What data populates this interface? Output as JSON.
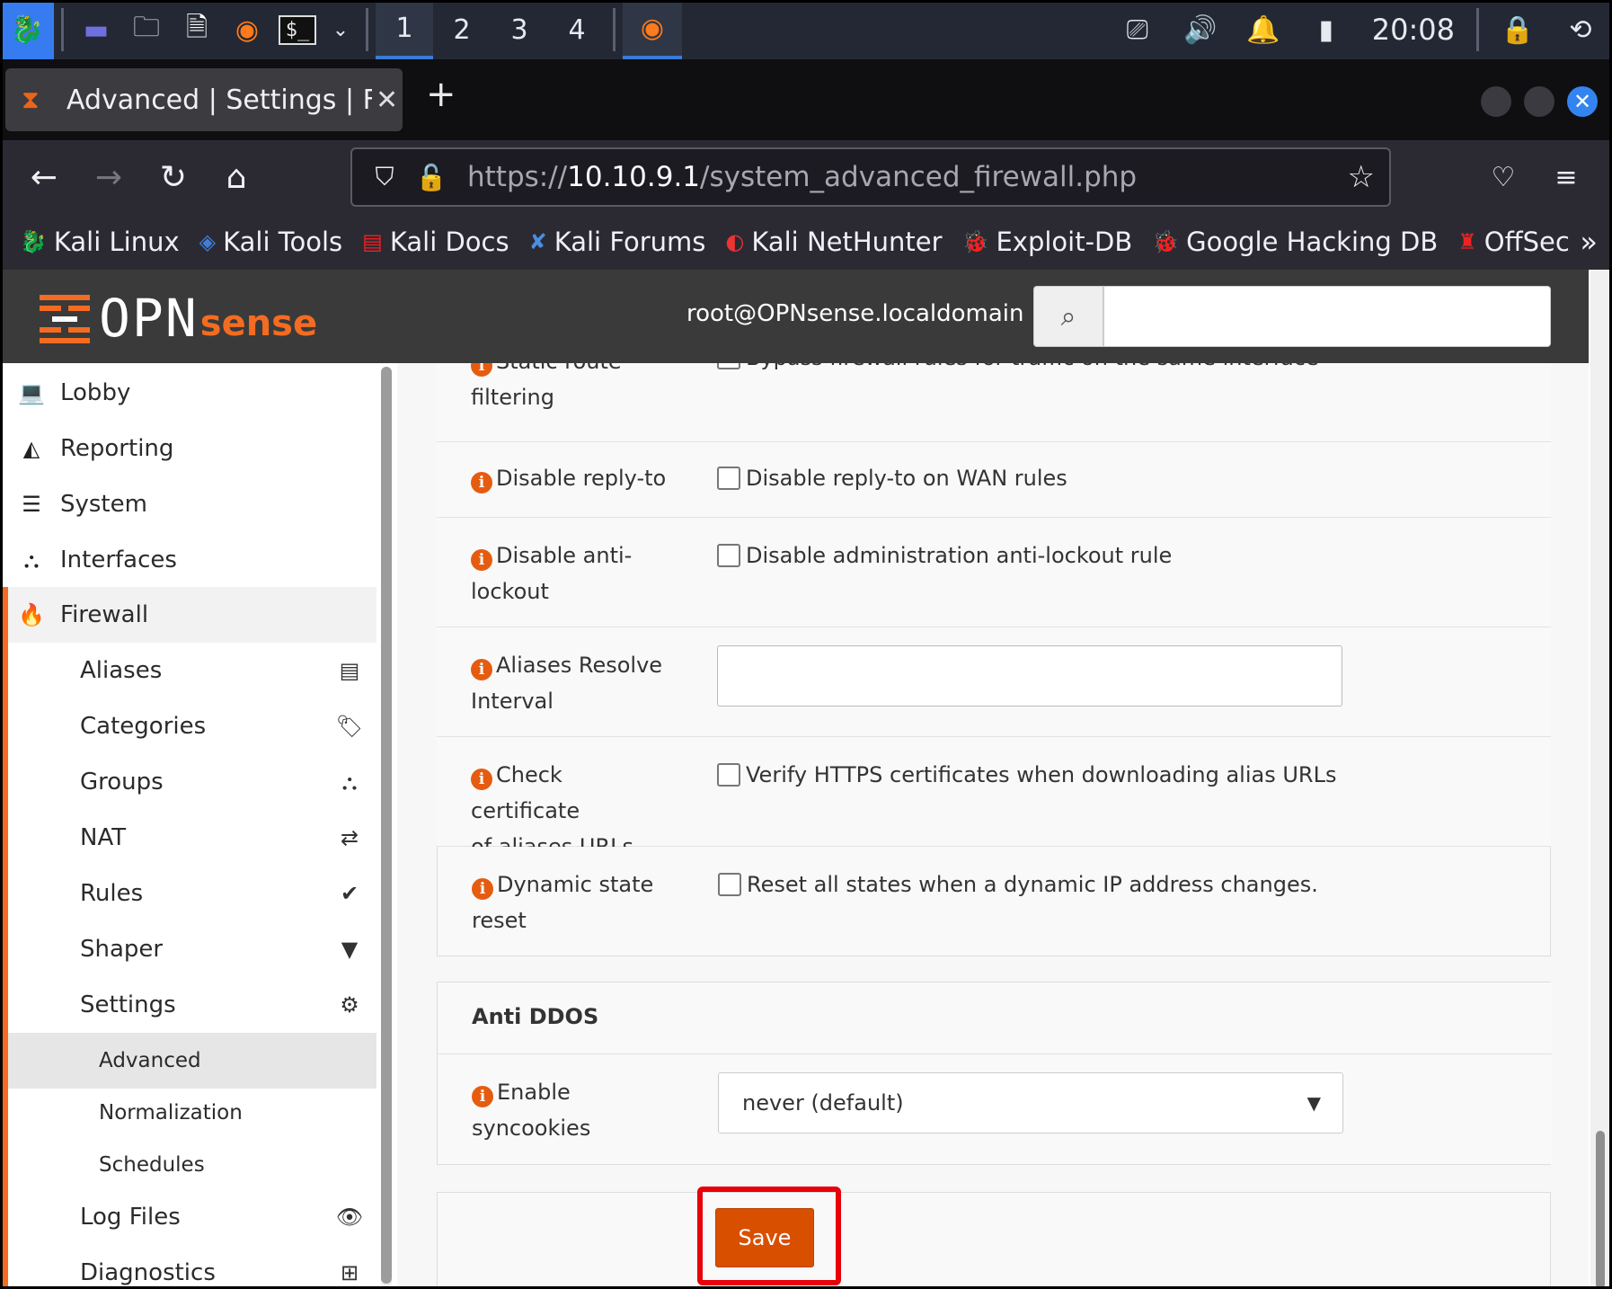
{
  "taskbar": {
    "workspaces": [
      "1",
      "2",
      "3",
      "4"
    ],
    "clock": "20:08"
  },
  "browser": {
    "tab_title": "Advanced | Settings | Firewall",
    "url_scheme": "https://",
    "url_host": "10.10.9.1",
    "url_path": "/system_advanced_firewall.php",
    "bookmarks": [
      "Kali Linux",
      "Kali Tools",
      "Kali Docs",
      "Kali Forums",
      "Kali NetHunter",
      "Exploit-DB",
      "Google Hacking DB",
      "OffSec"
    ]
  },
  "header": {
    "logo_opn": "OPN",
    "logo_sense": "sense",
    "user": "root@OPNsense.localdomain"
  },
  "sidebar": {
    "top": [
      {
        "label": "Lobby",
        "icon": "laptop-icon"
      },
      {
        "label": "Reporting",
        "icon": "area-chart-icon"
      },
      {
        "label": "System",
        "icon": "server-icon"
      },
      {
        "label": "Interfaces",
        "icon": "sitemap-icon"
      },
      {
        "label": "Firewall",
        "icon": "fire-icon"
      }
    ],
    "firewall_sub": [
      {
        "label": "Aliases",
        "icon": "list-icon"
      },
      {
        "label": "Categories",
        "icon": "tags-icon"
      },
      {
        "label": "Groups",
        "icon": "sitemap-icon"
      },
      {
        "label": "NAT",
        "icon": "exchange-icon"
      },
      {
        "label": "Rules",
        "icon": "check-icon"
      },
      {
        "label": "Shaper",
        "icon": "filter-icon"
      },
      {
        "label": "Settings",
        "icon": "cogs-icon"
      }
    ],
    "settings_sub": [
      "Advanced",
      "Normalization",
      "Schedules"
    ],
    "bottom": [
      {
        "label": "Log Files",
        "icon": "eye-icon"
      },
      {
        "label": "Diagnostics",
        "icon": "medkit-icon"
      }
    ]
  },
  "form": {
    "rows": [
      {
        "label_line1": "Static route",
        "label_line2": "filtering",
        "option": "Bypass firewall rules for traffic on the same interface"
      },
      {
        "label_line1": "Disable reply-to",
        "label_line2": "",
        "option": "Disable reply-to on WAN rules"
      },
      {
        "label_line1": "Disable anti-",
        "label_line2": "lockout",
        "option": "Disable administration anti-lockout rule"
      },
      {
        "label_line1": "Aliases Resolve",
        "label_line2": "Interval",
        "option": ""
      },
      {
        "label_line1": "Check certificate",
        "label_line2": "of aliases URLs",
        "option": "Verify HTTPS certificates when downloading alias URLs"
      },
      {
        "label_line1": "Dynamic state",
        "label_line2": "reset",
        "option": "Reset all states when a dynamic IP address changes."
      }
    ],
    "anti_ddos": {
      "title": "Anti DDOS",
      "label_line1": "Enable",
      "label_line2": "syncookies",
      "selected": "never (default)"
    },
    "save_label": "Save"
  }
}
